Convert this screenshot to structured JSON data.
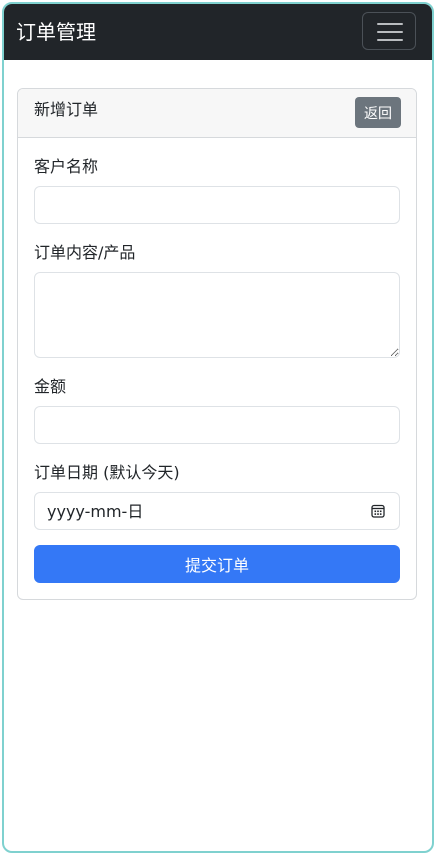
{
  "navbar": {
    "brand": "订单管理",
    "toggler_icon": "hamburger-menu-icon"
  },
  "card": {
    "title": "新增订单",
    "back_label": "返回"
  },
  "form": {
    "customer_label": "客户名称",
    "customer_value": "",
    "content_label": "订单内容/产品",
    "content_value": "",
    "amount_label": "金额",
    "amount_value": "",
    "date_label": "订单日期 (默认今天)",
    "date_value": "yyyy-mm-日",
    "date_icon": "calendar-icon",
    "submit_label": "提交订单"
  },
  "colors": {
    "navbar_bg": "#212529",
    "primary": "#3478f6",
    "secondary": "#6c757d",
    "frame_border": "#7fd1cf"
  }
}
